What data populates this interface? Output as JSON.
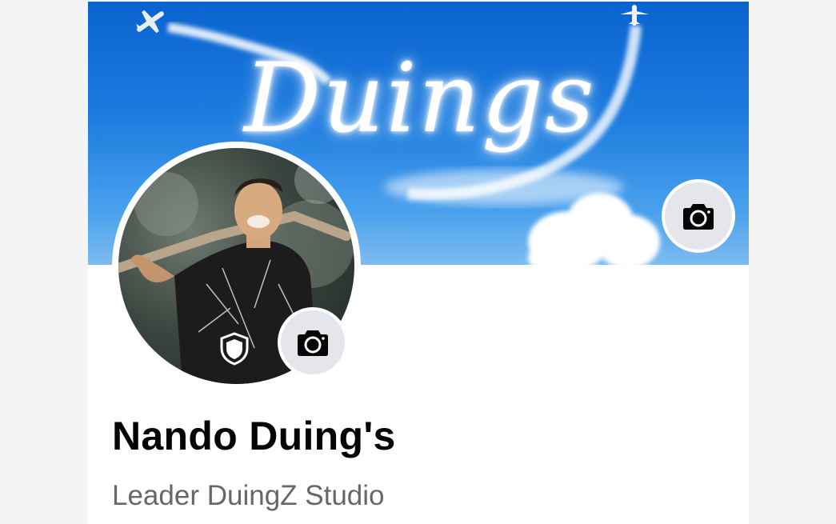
{
  "cover": {
    "text": "Duings",
    "camera_icon": "camera-icon",
    "colors": {
      "sky_top": "#0a63cf",
      "sky_bottom": "#7dbcf1"
    }
  },
  "avatar": {
    "shield_icon": "shield-icon",
    "camera_icon": "camera-icon"
  },
  "profile": {
    "name": "Nando Duing's",
    "bio": "Leader DuingZ Studio"
  },
  "colors": {
    "button_bg": "#e4e6eb",
    "name": "#050505",
    "bio": "#65676b"
  }
}
